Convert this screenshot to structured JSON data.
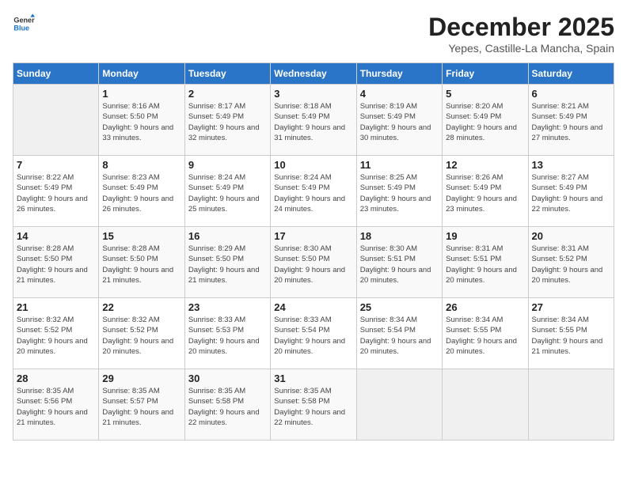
{
  "logo": {
    "general": "General",
    "blue": "Blue"
  },
  "title": {
    "month": "December 2025",
    "location": "Yepes, Castille-La Mancha, Spain"
  },
  "headers": [
    "Sunday",
    "Monday",
    "Tuesday",
    "Wednesday",
    "Thursday",
    "Friday",
    "Saturday"
  ],
  "weeks": [
    [
      {
        "day": "",
        "sunrise": "",
        "sunset": "",
        "daylight": ""
      },
      {
        "day": "1",
        "sunrise": "Sunrise: 8:16 AM",
        "sunset": "Sunset: 5:50 PM",
        "daylight": "Daylight: 9 hours and 33 minutes."
      },
      {
        "day": "2",
        "sunrise": "Sunrise: 8:17 AM",
        "sunset": "Sunset: 5:49 PM",
        "daylight": "Daylight: 9 hours and 32 minutes."
      },
      {
        "day": "3",
        "sunrise": "Sunrise: 8:18 AM",
        "sunset": "Sunset: 5:49 PM",
        "daylight": "Daylight: 9 hours and 31 minutes."
      },
      {
        "day": "4",
        "sunrise": "Sunrise: 8:19 AM",
        "sunset": "Sunset: 5:49 PM",
        "daylight": "Daylight: 9 hours and 30 minutes."
      },
      {
        "day": "5",
        "sunrise": "Sunrise: 8:20 AM",
        "sunset": "Sunset: 5:49 PM",
        "daylight": "Daylight: 9 hours and 28 minutes."
      },
      {
        "day": "6",
        "sunrise": "Sunrise: 8:21 AM",
        "sunset": "Sunset: 5:49 PM",
        "daylight": "Daylight: 9 hours and 27 minutes."
      }
    ],
    [
      {
        "day": "7",
        "sunrise": "Sunrise: 8:22 AM",
        "sunset": "Sunset: 5:49 PM",
        "daylight": "Daylight: 9 hours and 26 minutes."
      },
      {
        "day": "8",
        "sunrise": "Sunrise: 8:23 AM",
        "sunset": "Sunset: 5:49 PM",
        "daylight": "Daylight: 9 hours and 26 minutes."
      },
      {
        "day": "9",
        "sunrise": "Sunrise: 8:24 AM",
        "sunset": "Sunset: 5:49 PM",
        "daylight": "Daylight: 9 hours and 25 minutes."
      },
      {
        "day": "10",
        "sunrise": "Sunrise: 8:24 AM",
        "sunset": "Sunset: 5:49 PM",
        "daylight": "Daylight: 9 hours and 24 minutes."
      },
      {
        "day": "11",
        "sunrise": "Sunrise: 8:25 AM",
        "sunset": "Sunset: 5:49 PM",
        "daylight": "Daylight: 9 hours and 23 minutes."
      },
      {
        "day": "12",
        "sunrise": "Sunrise: 8:26 AM",
        "sunset": "Sunset: 5:49 PM",
        "daylight": "Daylight: 9 hours and 23 minutes."
      },
      {
        "day": "13",
        "sunrise": "Sunrise: 8:27 AM",
        "sunset": "Sunset: 5:49 PM",
        "daylight": "Daylight: 9 hours and 22 minutes."
      }
    ],
    [
      {
        "day": "14",
        "sunrise": "Sunrise: 8:28 AM",
        "sunset": "Sunset: 5:50 PM",
        "daylight": "Daylight: 9 hours and 21 minutes."
      },
      {
        "day": "15",
        "sunrise": "Sunrise: 8:28 AM",
        "sunset": "Sunset: 5:50 PM",
        "daylight": "Daylight: 9 hours and 21 minutes."
      },
      {
        "day": "16",
        "sunrise": "Sunrise: 8:29 AM",
        "sunset": "Sunset: 5:50 PM",
        "daylight": "Daylight: 9 hours and 21 minutes."
      },
      {
        "day": "17",
        "sunrise": "Sunrise: 8:30 AM",
        "sunset": "Sunset: 5:50 PM",
        "daylight": "Daylight: 9 hours and 20 minutes."
      },
      {
        "day": "18",
        "sunrise": "Sunrise: 8:30 AM",
        "sunset": "Sunset: 5:51 PM",
        "daylight": "Daylight: 9 hours and 20 minutes."
      },
      {
        "day": "19",
        "sunrise": "Sunrise: 8:31 AM",
        "sunset": "Sunset: 5:51 PM",
        "daylight": "Daylight: 9 hours and 20 minutes."
      },
      {
        "day": "20",
        "sunrise": "Sunrise: 8:31 AM",
        "sunset": "Sunset: 5:52 PM",
        "daylight": "Daylight: 9 hours and 20 minutes."
      }
    ],
    [
      {
        "day": "21",
        "sunrise": "Sunrise: 8:32 AM",
        "sunset": "Sunset: 5:52 PM",
        "daylight": "Daylight: 9 hours and 20 minutes."
      },
      {
        "day": "22",
        "sunrise": "Sunrise: 8:32 AM",
        "sunset": "Sunset: 5:52 PM",
        "daylight": "Daylight: 9 hours and 20 minutes."
      },
      {
        "day": "23",
        "sunrise": "Sunrise: 8:33 AM",
        "sunset": "Sunset: 5:53 PM",
        "daylight": "Daylight: 9 hours and 20 minutes."
      },
      {
        "day": "24",
        "sunrise": "Sunrise: 8:33 AM",
        "sunset": "Sunset: 5:54 PM",
        "daylight": "Daylight: 9 hours and 20 minutes."
      },
      {
        "day": "25",
        "sunrise": "Sunrise: 8:34 AM",
        "sunset": "Sunset: 5:54 PM",
        "daylight": "Daylight: 9 hours and 20 minutes."
      },
      {
        "day": "26",
        "sunrise": "Sunrise: 8:34 AM",
        "sunset": "Sunset: 5:55 PM",
        "daylight": "Daylight: 9 hours and 20 minutes."
      },
      {
        "day": "27",
        "sunrise": "Sunrise: 8:34 AM",
        "sunset": "Sunset: 5:55 PM",
        "daylight": "Daylight: 9 hours and 21 minutes."
      }
    ],
    [
      {
        "day": "28",
        "sunrise": "Sunrise: 8:35 AM",
        "sunset": "Sunset: 5:56 PM",
        "daylight": "Daylight: 9 hours and 21 minutes."
      },
      {
        "day": "29",
        "sunrise": "Sunrise: 8:35 AM",
        "sunset": "Sunset: 5:57 PM",
        "daylight": "Daylight: 9 hours and 21 minutes."
      },
      {
        "day": "30",
        "sunrise": "Sunrise: 8:35 AM",
        "sunset": "Sunset: 5:58 PM",
        "daylight": "Daylight: 9 hours and 22 minutes."
      },
      {
        "day": "31",
        "sunrise": "Sunrise: 8:35 AM",
        "sunset": "Sunset: 5:58 PM",
        "daylight": "Daylight: 9 hours and 22 minutes."
      },
      {
        "day": "",
        "sunrise": "",
        "sunset": "",
        "daylight": ""
      },
      {
        "day": "",
        "sunrise": "",
        "sunset": "",
        "daylight": ""
      },
      {
        "day": "",
        "sunrise": "",
        "sunset": "",
        "daylight": ""
      }
    ]
  ]
}
